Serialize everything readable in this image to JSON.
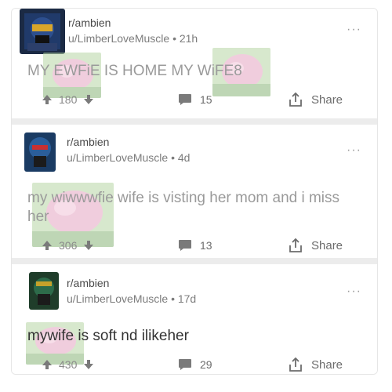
{
  "posts": [
    {
      "subreddit": "r/ambien",
      "user": "u/LimberLoveMuscle",
      "age": "21h",
      "title": "MY EWFiE IS HOME MY WiFE8",
      "upvotes": "180",
      "comments": "15",
      "share_label": "Share",
      "more_label": "···"
    },
    {
      "subreddit": "r/ambien",
      "user": "u/LimberLoveMuscle",
      "age": "4d",
      "title": "my wiwwwfie wife is visting her mom and i miss her",
      "upvotes": "306",
      "comments": "13",
      "share_label": "Share",
      "more_label": "···"
    },
    {
      "subreddit": "r/ambien",
      "user": "u/LimberLoveMuscle",
      "age": "17d",
      "title": "mywife is soft nd ilikeher",
      "upvotes": "430",
      "comments": "29",
      "share_label": "Share",
      "more_label": "···"
    }
  ],
  "separator": "•",
  "colors": {
    "card_bg": "#ffffff",
    "divider": "#ececec",
    "faded_text": "#9a9a9a",
    "dark_text": "#333333",
    "meta_text": "#7c7c7c",
    "icon_gray": "#7a7a7a",
    "photo_pink": "#e5a6c3",
    "photo_green": "#8ab67a"
  },
  "icons": {
    "upvote": "arrow-up-icon",
    "downvote": "arrow-down-icon",
    "comment": "comment-bubble-icon",
    "share": "share-icon",
    "more": "more-dots-icon"
  }
}
